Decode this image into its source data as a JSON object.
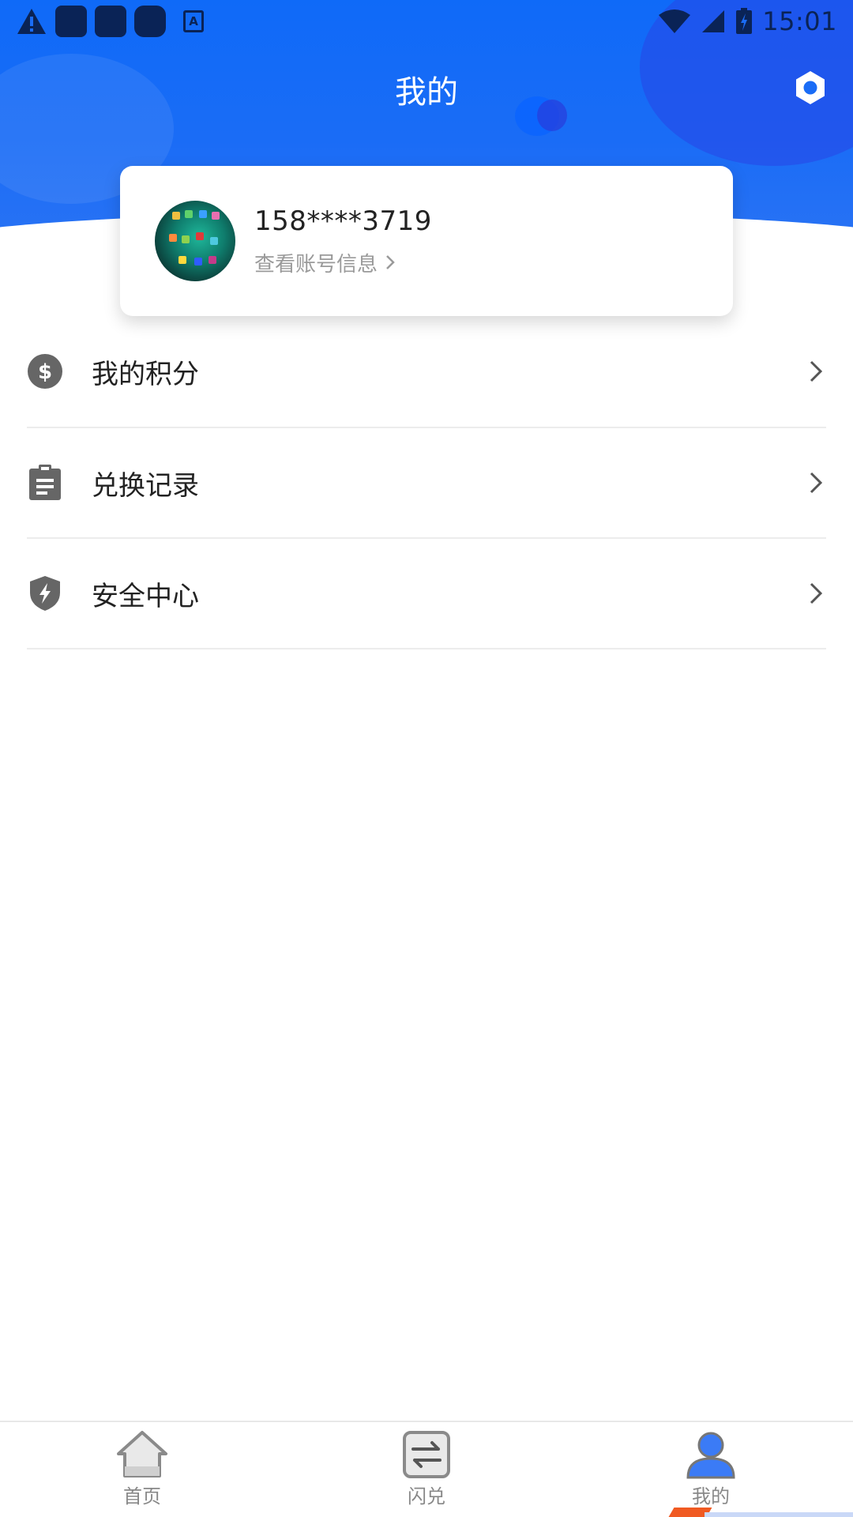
{
  "status_bar": {
    "time": "15:01"
  },
  "header": {
    "title": "我的"
  },
  "profile": {
    "phone": "158****3719",
    "account_link": "查看账号信息",
    "link_arrow": "›"
  },
  "menu": {
    "items": [
      {
        "label": "我的积分",
        "icon": "dollar-coin-icon"
      },
      {
        "label": "兑换记录",
        "icon": "clipboard-icon"
      },
      {
        "label": "安全中心",
        "icon": "shield-bolt-icon"
      }
    ]
  },
  "bottom_nav": {
    "items": [
      {
        "label": "首页",
        "icon": "home-icon"
      },
      {
        "label": "闪兑",
        "icon": "exchange-icon"
      },
      {
        "label": "我的",
        "icon": "user-icon",
        "active": true
      }
    ]
  },
  "colors": {
    "header_blue": "#1a6cf6",
    "active_icon": "#3b7bf6",
    "icon_gray": "#666666"
  }
}
